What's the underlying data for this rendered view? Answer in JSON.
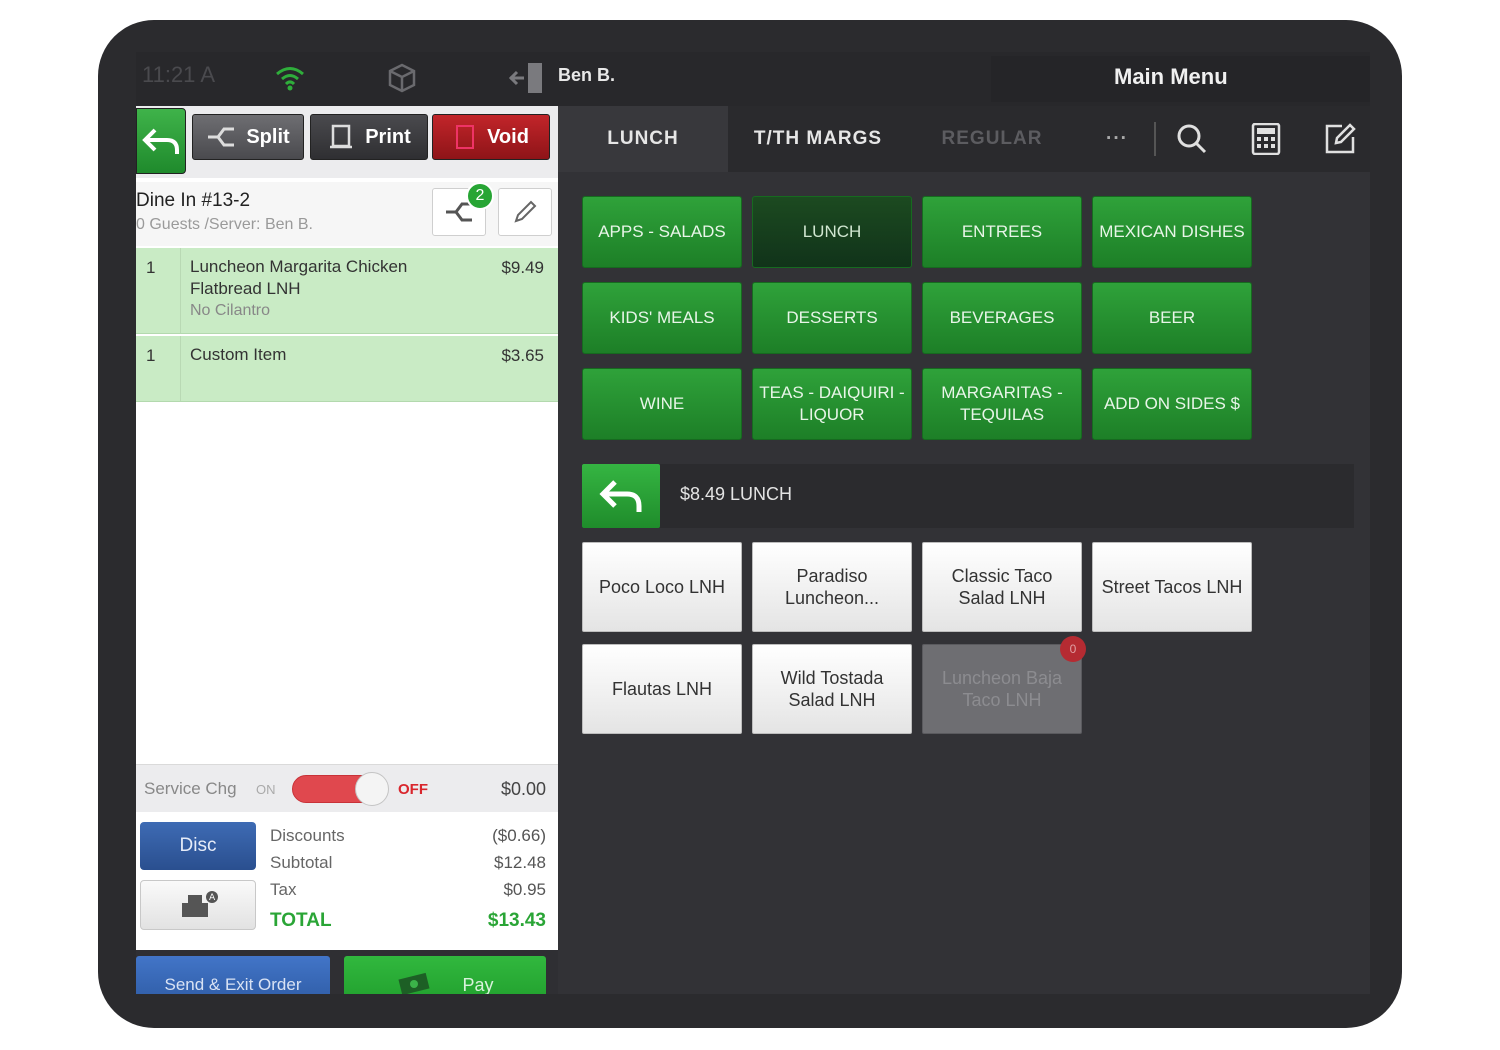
{
  "status": {
    "time": "11:21 A",
    "user": "Ben B.",
    "title": "Main Menu"
  },
  "toolbar": {
    "split": "Split",
    "print": "Print",
    "void": "Void"
  },
  "order": {
    "title": "Dine In #13-2",
    "subtitle": "0 Guests /Server: Ben B.",
    "split_badge": "2",
    "lines": [
      {
        "qty": "1",
        "name": "Luncheon Margarita Chicken Flatbread LNH",
        "modifier": "No Cilantro",
        "price": "$9.49"
      },
      {
        "qty": "1",
        "name": "Custom Item",
        "modifier": "",
        "price": "$3.65"
      }
    ]
  },
  "service": {
    "label": "Service Chg",
    "on": "ON",
    "off": "OFF",
    "amount": "$0.00"
  },
  "totals": {
    "disc_button": "Disc",
    "discounts_label": "Discounts",
    "discounts": "($0.66)",
    "subtotal_label": "Subtotal",
    "subtotal": "$12.48",
    "tax_label": "Tax",
    "tax": "$0.95",
    "total_label": "TOTAL",
    "total": "$13.43"
  },
  "actions": {
    "send": "Send & Exit Order",
    "pay": "Pay"
  },
  "tabs": [
    "LUNCH",
    "T/TH MARGS",
    "REGULAR",
    "···"
  ],
  "categories": [
    "APPS - SALADS",
    "LUNCH",
    "ENTREES",
    "MEXICAN DISHES",
    "KIDS' MEALS",
    "DESSERTS",
    "BEVERAGES",
    "BEER",
    "WINE",
    "TEAS - DAIQUIRI - LIQUOR",
    "MARGARITAS - TEQUILAS",
    "ADD ON SIDES $"
  ],
  "selected_category": "LUNCH",
  "subcategory": "$8.49 LUNCH",
  "items": [
    "Poco Loco LNH",
    "Paradiso Luncheon...",
    "Classic Taco Salad LNH",
    "Street Tacos LNH",
    "Flautas LNH",
    "Wild Tostada Salad LNH",
    "Luncheon Baja Taco LNH"
  ],
  "item_badge": "0",
  "colors": {
    "accent_green": "#2fa23a",
    "void_red": "#c2252a",
    "send_blue": "#4275c8",
    "order_line_green": "#c9ebc5"
  }
}
